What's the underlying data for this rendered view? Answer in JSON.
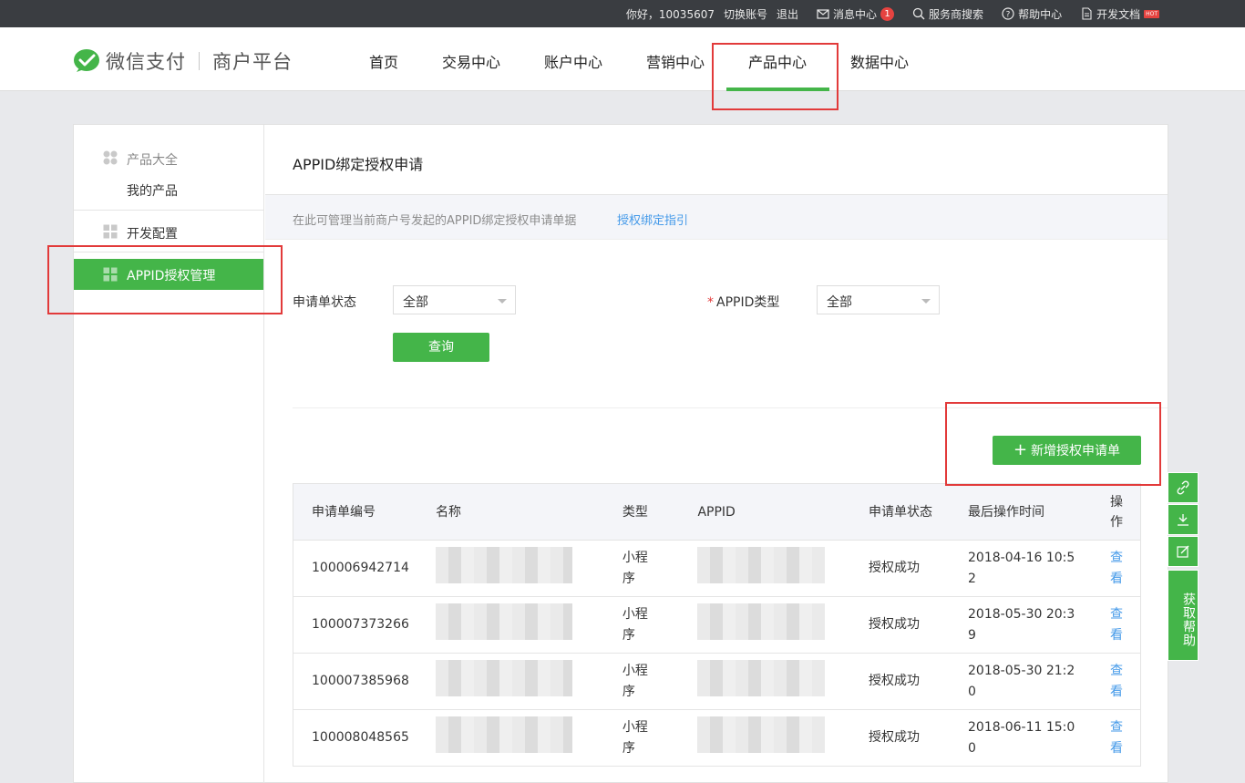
{
  "topbar": {
    "greeting": "你好，10035607",
    "switch_account": "切换账号",
    "logout": "退出",
    "message_center": "消息中心",
    "message_count": "1",
    "provider_search": "服务商搜索",
    "help_center": "帮助中心",
    "dev_docs": "开发文档",
    "hot_badge": "HOT"
  },
  "header": {
    "brand": "微信支付",
    "platform": "商户平台",
    "nav": [
      "首页",
      "交易中心",
      "账户中心",
      "营销中心",
      "产品中心",
      "数据中心"
    ],
    "active_nav": "产品中心"
  },
  "sidebar": {
    "group_title": "产品大全",
    "my_products": "我的产品",
    "dev_config": "开发配置",
    "appid_mgmt": "APPID授权管理"
  },
  "content": {
    "title": "APPID绑定授权申请",
    "info_text": "在此可管理当前商户号发起的APPID绑定授权申请单据",
    "info_link": "授权绑定指引",
    "filter_status_label": "申请单状态",
    "filter_status_value": "全部",
    "filter_type_required": "*",
    "filter_type_label": "APPID类型",
    "filter_type_value": "全部",
    "query_button": "查询",
    "add_button": "新增授权申请单"
  },
  "table": {
    "headers": [
      "申请单编号",
      "名称",
      "类型",
      "APPID",
      "申请单状态",
      "最后操作时间",
      "操作"
    ],
    "rows": [
      {
        "id": "100006942714",
        "type": "小程序",
        "status": "授权成功",
        "time": "2018-04-16 10:52",
        "action": "查看"
      },
      {
        "id": "100007373266",
        "type": "小程序",
        "status": "授权成功",
        "time": "2018-05-30 20:39",
        "action": "查看"
      },
      {
        "id": "100007385968",
        "type": "小程序",
        "status": "授权成功",
        "time": "2018-05-30 21:20",
        "action": "查看"
      },
      {
        "id": "100008048565",
        "type": "小程序",
        "status": "授权成功",
        "time": "2018-06-11 15:00",
        "action": "查看"
      }
    ]
  },
  "float_tools": {
    "help": "获取帮助"
  },
  "colors": {
    "accent": "#44b549",
    "link": "#459ae9",
    "highlight_box": "#e23a3a"
  }
}
